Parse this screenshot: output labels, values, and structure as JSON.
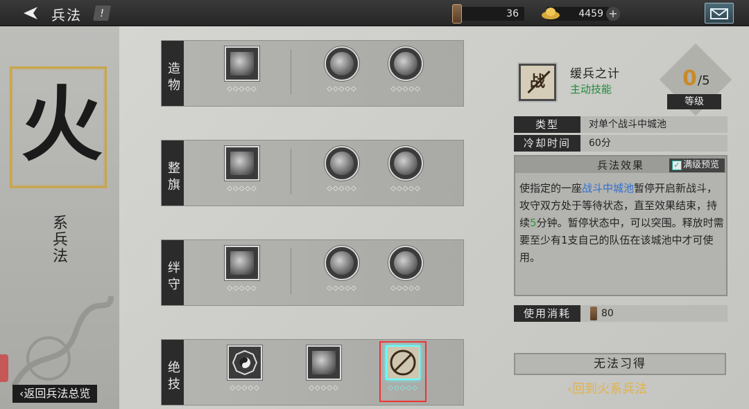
{
  "header": {
    "title": "兵法",
    "info_icon": "!",
    "resources": [
      {
        "icon": "token-icon",
        "value": "36"
      },
      {
        "icon": "gold-ingot-icon",
        "value": "4459"
      }
    ],
    "plus": "+"
  },
  "left_panel": {
    "seal_char": "火",
    "school_label": "系兵法",
    "return_overview": "‹返回兵法总览"
  },
  "rows": [
    {
      "label": "造物",
      "skills": [
        {
          "icon": "vortex-scroll-icon",
          "shape": "square",
          "dots": "◇◇◇◇◇"
        },
        {
          "icon": "warrior-icon",
          "shape": "round",
          "dots": "◇◇◇◇◇"
        },
        {
          "icon": "banner-icon",
          "shape": "round",
          "dots": "◇◇◇◇◇"
        }
      ]
    },
    {
      "label": "整旗",
      "skills": [
        {
          "icon": "soldier-flag-icon",
          "shape": "square",
          "dots": "◇◇◇◇◇"
        },
        {
          "icon": "trident-icon",
          "shape": "round",
          "dots": "◇◇◇◇◇"
        },
        {
          "icon": "arrow-scroll-icon",
          "shape": "round",
          "dots": "◇◇◇◇◇"
        }
      ]
    },
    {
      "label": "绊守",
      "skills": [
        {
          "icon": "flame-warrior-icon",
          "shape": "square",
          "dots": "◇◇◇◇◇"
        },
        {
          "icon": "horse-icon",
          "shape": "round",
          "dots": "◇◇◇◇◇"
        },
        {
          "icon": "cannon-troops-icon",
          "shape": "round",
          "dots": "◇◇◇◇◇"
        }
      ]
    },
    {
      "label": "绝技",
      "skills": [
        {
          "icon": "bagua-icon",
          "shape": "square",
          "dots": "◇◇◇◇◇"
        },
        {
          "icon": "cannon-icon",
          "shape": "square",
          "dots": "◇◇◇◇◇"
        },
        {
          "icon": "no-battle-icon",
          "shape": "square",
          "dots": "◇◇◇◇◇",
          "selected": true
        }
      ]
    }
  ],
  "detail": {
    "icon_char": "战",
    "name": "缓兵之计",
    "kind": "主动技能",
    "level_current": "0",
    "level_max": "/5",
    "level_label": "等级",
    "attrs": [
      {
        "key": "类型",
        "value": "对单个战斗中城池"
      },
      {
        "key": "冷却时间",
        "value": "60分"
      }
    ],
    "effect_title": "兵法效果",
    "max_preview": "满级预览",
    "effect_parts": {
      "p1": "使指定的一座",
      "hl1": "战斗中城池",
      "p2": "暂停开启新战斗，攻守双方处于等待状态，直至效果结束，持续",
      "hl2": "5",
      "p3": "分钟。暂停状态中，可以突围。释放时需要至少有1支自己的队伍在该城池中才可使用。"
    },
    "cost_key": "使用消耗",
    "cost_value": "80",
    "unable_button": "无法习得",
    "return_fire": "‹回到火系兵法"
  },
  "colors": {
    "accent_gold": "#e3b248",
    "skill_type_green": "#1f8a3a",
    "highlight_blue": "#2f6fcf",
    "selected_outline": "#e33333"
  }
}
